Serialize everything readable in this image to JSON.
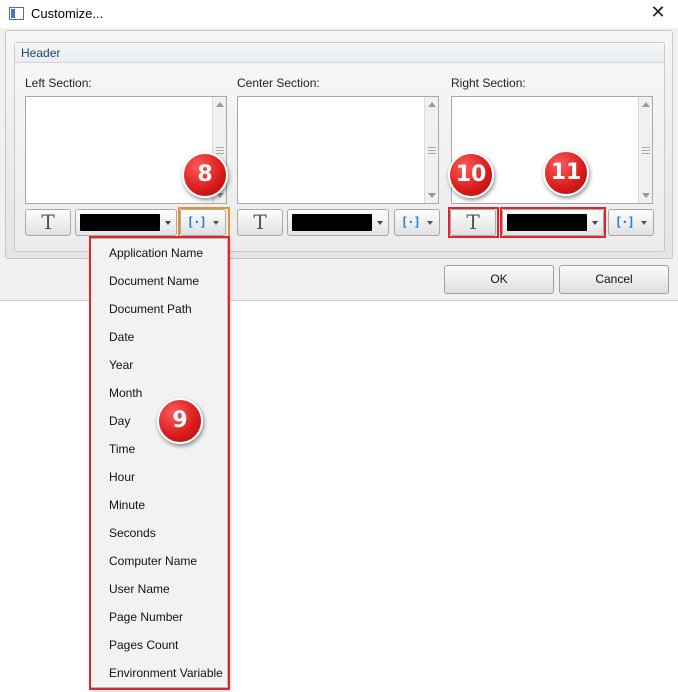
{
  "window": {
    "title": "Customize...",
    "close_glyph": "✕"
  },
  "group": {
    "title": "Header"
  },
  "sections": [
    {
      "label": "Left Section:",
      "text": ""
    },
    {
      "label": "Center Section:",
      "text": ""
    },
    {
      "label": "Right Section:",
      "text": ""
    }
  ],
  "toolbar": {
    "font_glyph": "T",
    "variable_glyph": "[·]",
    "color_value": "#000000"
  },
  "buttons": {
    "ok": "OK",
    "cancel": "Cancel"
  },
  "variable_menu": {
    "items": [
      "Application Name",
      "Document Name",
      "Document Path",
      "Date",
      "Year",
      "Month",
      "Day",
      "Time",
      "Hour",
      "Minute",
      "Seconds",
      "Computer Name",
      "User Name",
      "Page Number",
      "Pages Count",
      "Environment Variable"
    ]
  },
  "annotations": {
    "callout_8": "8",
    "callout_9": "9",
    "callout_10": "10",
    "callout_11": "11",
    "highlight_color": "#e0262c",
    "orange_color": "#e8902a"
  }
}
